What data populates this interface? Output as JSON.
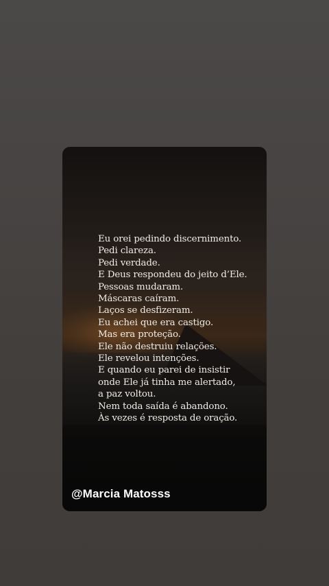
{
  "story": {
    "poem_lines": [
      "Eu orei pedindo discernimento.",
      "Pedi clareza.",
      "Pedi verdade.",
      "E Deus respondeu do jeito d’Ele.",
      "Pessoas mudaram.",
      "Máscaras caíram.",
      "Laços se desfizeram.",
      "Eu achei que era castigo.",
      "Mas era proteção.",
      "Ele não destruiu relações.",
      "Ele revelou intenções.",
      "E quando eu parei de insistir",
      "onde Ele já tinha me alertado,",
      "a paz voltou.",
      "Nem toda saída é abandono.",
      "Às vezes é resposta de oração."
    ],
    "handle": "@Marcia Matosss"
  },
  "colors": {
    "page_background": "#474443",
    "text": "#f1ece6",
    "handle_text": "#ffffff"
  }
}
